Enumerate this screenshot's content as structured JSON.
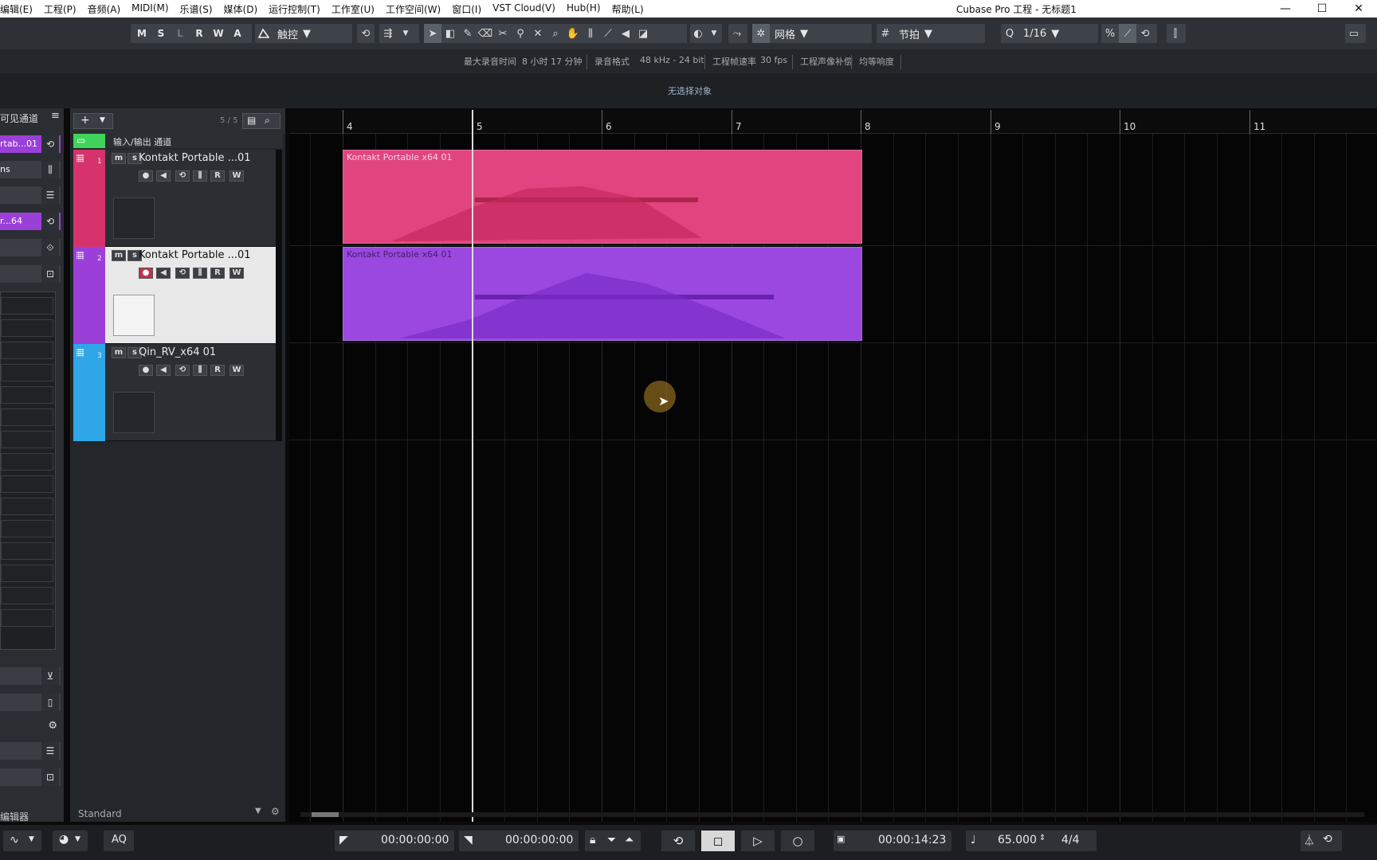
{
  "menubar": {
    "items": [
      "编辑(E)",
      "工程(P)",
      "音频(A)",
      "MIDI(M)",
      "乐谱(S)",
      "媒体(D)",
      "运行控制(T)",
      "工作室(U)",
      "工作空间(W)",
      "窗口(I)",
      "VST Cloud(V)",
      "Hub(H)",
      "帮助(L)"
    ],
    "window_title": "Cubase Pro 工程 - 无标题1",
    "min": "—",
    "max": "☐",
    "close": "✕"
  },
  "toolbar": {
    "states": [
      "M",
      "S",
      "L",
      "R",
      "W",
      "A"
    ],
    "automation_mode": "触控",
    "snap_type": "网格",
    "grid_type": "节拍",
    "quantize": "1/16"
  },
  "status": {
    "max_rec_label": "最大录音时间",
    "max_rec_value": "8 小时 17 分钟",
    "rec_format_label": "录音格式",
    "rec_format_value": "48 kHz - 24 bit",
    "frame_rate_label": "工程帧速率",
    "frame_rate_value": "30 fps",
    "pan_law_label": "工程声像补偿",
    "pan_law_value": "均等响度",
    "info_line": "无选择对象"
  },
  "inspector": {
    "header": "可见通道",
    "track_name_short": "rtab...01",
    "ins_label": "ns",
    "instrument_short": "r...64",
    "editor_label": "编辑器"
  },
  "tracklist": {
    "count": "5 / 5",
    "io_folder": "输入/输出 通道",
    "zone_label": "Standard",
    "tracks": [
      {
        "num": "1",
        "name": "Kontakt Portable ...01",
        "color": "#d6336c"
      },
      {
        "num": "2",
        "name": "Kontakt Portable ...01",
        "color": "#9b3fd9"
      },
      {
        "num": "3",
        "name": "Qin_RV_x64 01",
        "color": "#2fa6e8"
      }
    ]
  },
  "ruler": {
    "bars": [
      "4",
      "5",
      "6",
      "7",
      "8",
      "9",
      "10",
      "11"
    ]
  },
  "parts": [
    {
      "name": "Kontakt Portable x64 01",
      "color": "#e0457f"
    },
    {
      "name": "Kontakt Portable x64 01",
      "color": "#9a48e0"
    }
  ],
  "transport": {
    "left_locator": "00:00:00:00",
    "right_locator": "00:00:00:00",
    "position": "00:00:14:23",
    "tempo": "65.000",
    "signature": "4/4",
    "aq": "AQ"
  }
}
